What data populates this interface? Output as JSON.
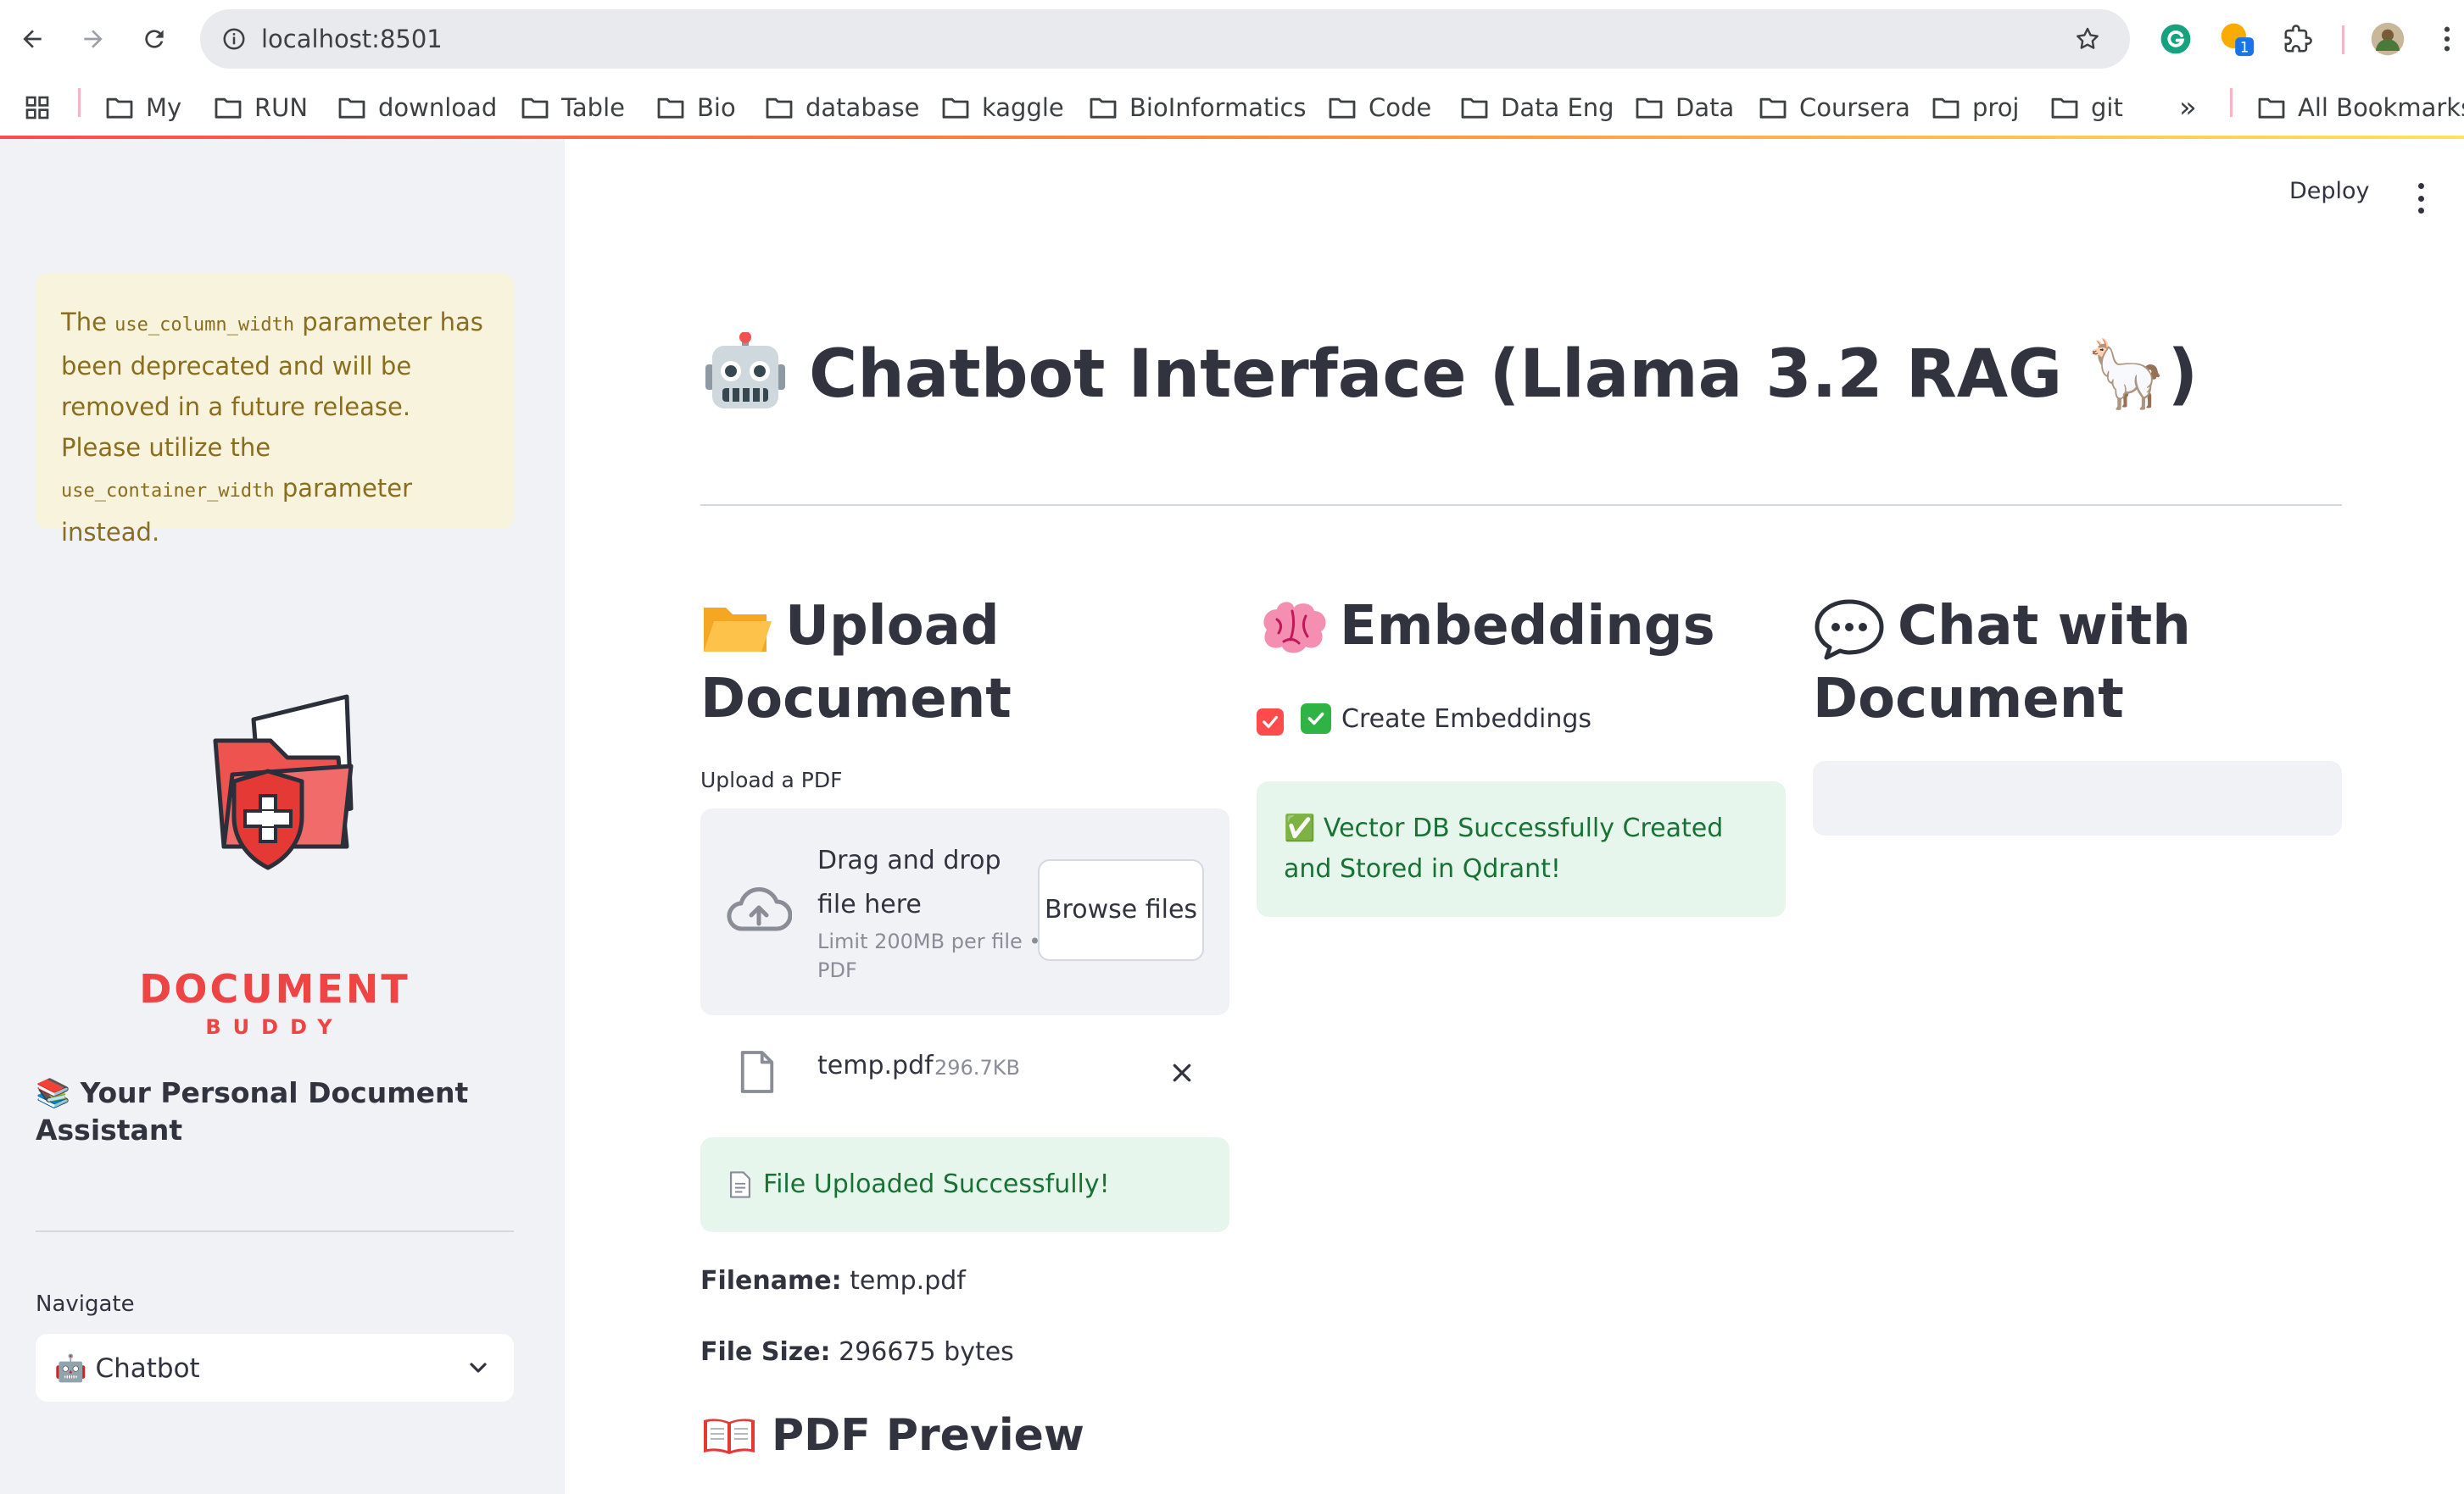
{
  "browser": {
    "url": "localhost:8501",
    "bookmarks": [
      "My",
      "RUN",
      "download",
      "Table",
      "Bio",
      "database",
      "kaggle",
      "BioInformatics",
      "Code",
      "Data Eng",
      "Data",
      "Coursera",
      "proj",
      "git"
    ],
    "more": "»",
    "all_bookmarks": "All Bookmarks",
    "extension_badge": "1"
  },
  "sidebar": {
    "warning": {
      "p1": "The ",
      "code1": "use_column_width",
      "p2": " parameter has been deprecated and will be removed in a future release. Please utilize the ",
      "code2": "use_container_width",
      "p3": " parameter instead."
    },
    "logo_title": "DOCUMENT",
    "logo_sub": "BUDDY",
    "assistant_title": "📚 Your Personal Document Assistant",
    "nav_label": "Navigate",
    "nav_value": "🤖 Chatbot"
  },
  "header": {
    "deploy_label": "Deploy"
  },
  "main": {
    "title": "Chatbot Interface (Llama 3.2 RAG 🦙)",
    "upload": {
      "heading_line1": "Upload",
      "heading_line2": "Document",
      "label": "Upload a PDF",
      "drag_text": "Drag and drop file here",
      "limit_text": "Limit 200MB per file • PDF",
      "browse_label": "Browse files",
      "file_name": "temp.pdf",
      "file_size": "296.7KB",
      "success": "File Uploaded Successfully!",
      "filename_label": "Filename:",
      "filename_value": "temp.pdf",
      "filesize_label": "File Size:",
      "filesize_value": "296675 bytes",
      "preview_heading": "PDF Preview"
    },
    "embeddings": {
      "heading": "Embeddings",
      "checkbox_label": "Create Embeddings",
      "checkbox_checked": true,
      "success": "✅ Vector DB Successfully Created and Stored in Qdrant!"
    },
    "chat": {
      "heading_line1": "Chat with",
      "heading_line2": "Document"
    }
  },
  "colors": {
    "accent": "#ff4b4b",
    "success_bg": "#e7f6ec",
    "success_text": "#177233",
    "warning_bg": "#f7f3dc",
    "warning_text": "#8a6d1e",
    "sidebar_bg": "#f0f2f6"
  }
}
